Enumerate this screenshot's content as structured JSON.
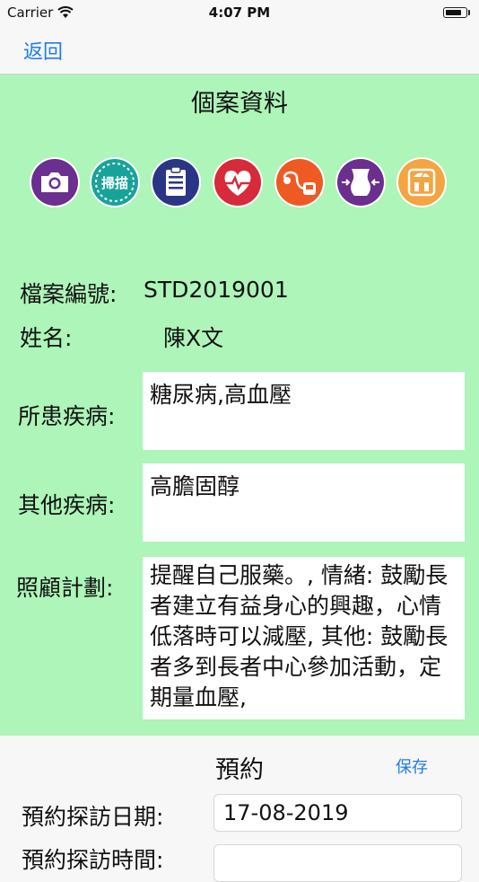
{
  "status_bar": {
    "carrier": "Carrier",
    "time": "4:07 PM"
  },
  "nav": {
    "back_label": "返回"
  },
  "case": {
    "title": "個案資料",
    "file_number_label": "檔案編號:",
    "file_number": "STD2019001",
    "name_label": "姓名:",
    "name": "陳X文",
    "diseases_label": "所患疾病:",
    "diseases": "糖尿病,高血壓",
    "other_diseases_label": "其他疾病:",
    "other_diseases": "高膽固醇",
    "care_plan_label": "照顧計劃:",
    "care_plan": "提醒自己服藥。, 情緒: 鼓勵長者建立有益身心的興趣，心情低落時可以減壓, 其他: 鼓勵長者多到長者中心參加活動，定期量血壓,"
  },
  "icons": {
    "scan_text": "掃描",
    "names": [
      "camera-icon",
      "scan-icon",
      "clipboard-icon",
      "heart-rate-icon",
      "blood-pressure-icon",
      "waist-icon",
      "weight-scale-icon"
    ],
    "colors": [
      "#6b2f8f",
      "#18a39a",
      "#2a3585",
      "#d72a3a",
      "#ef5a24",
      "#6b2f8f",
      "#f5a442"
    ]
  },
  "appointment": {
    "title": "預約",
    "save_label": "保存",
    "date_label": "預約探訪日期:",
    "date_value": "17-08-2019",
    "time_label": "預約探訪時間:"
  }
}
